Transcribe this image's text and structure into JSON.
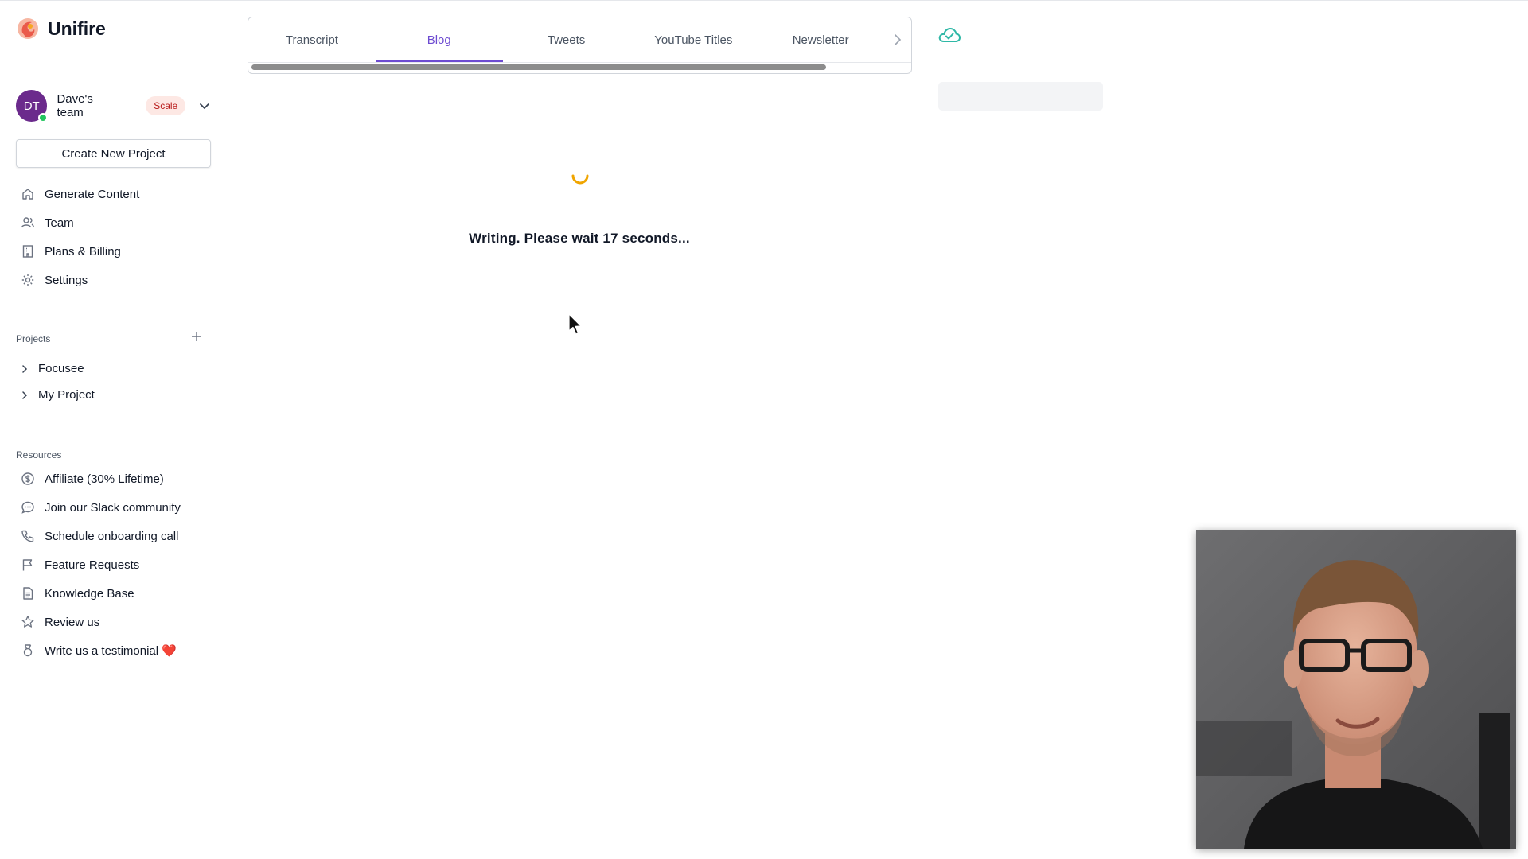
{
  "app": {
    "name": "Unifire"
  },
  "team": {
    "initials": "DT",
    "name": "Dave's team",
    "plan": "Scale"
  },
  "sidebar": {
    "create_button": "Create New Project",
    "nav": [
      {
        "label": "Generate Content",
        "icon": "home-icon"
      },
      {
        "label": "Team",
        "icon": "users-icon"
      },
      {
        "label": "Plans & Billing",
        "icon": "building-icon"
      },
      {
        "label": "Settings",
        "icon": "gear-icon"
      }
    ],
    "projects_label": "Projects",
    "projects": [
      {
        "label": "Focusee"
      },
      {
        "label": "My Project"
      }
    ],
    "resources_label": "Resources",
    "resources": [
      {
        "label": "Affiliate (30% Lifetime)",
        "icon": "dollar-circle-icon"
      },
      {
        "label": "Join our Slack community",
        "icon": "chat-bubble-icon"
      },
      {
        "label": "Schedule onboarding call",
        "icon": "phone-icon"
      },
      {
        "label": "Feature Requests",
        "icon": "flag-icon"
      },
      {
        "label": "Knowledge Base",
        "icon": "document-icon"
      },
      {
        "label": "Review us",
        "icon": "star-icon"
      },
      {
        "label": "Write us a testimonial ❤️",
        "icon": "medal-icon"
      }
    ]
  },
  "tabs": [
    {
      "label": "Transcript",
      "active": false
    },
    {
      "label": "Blog",
      "active": true
    },
    {
      "label": "Tweets",
      "active": false
    },
    {
      "label": "YouTube Titles",
      "active": false
    },
    {
      "label": "Newsletter",
      "active": false
    }
  ],
  "main": {
    "loading_text": "Writing. Please wait 17 seconds..."
  },
  "colors": {
    "accent": "#6d4bd1",
    "spinner": "#f0a500",
    "avatar": "#6b2a8c",
    "cloud": "#2fb8a6",
    "online": "#22c55e"
  }
}
